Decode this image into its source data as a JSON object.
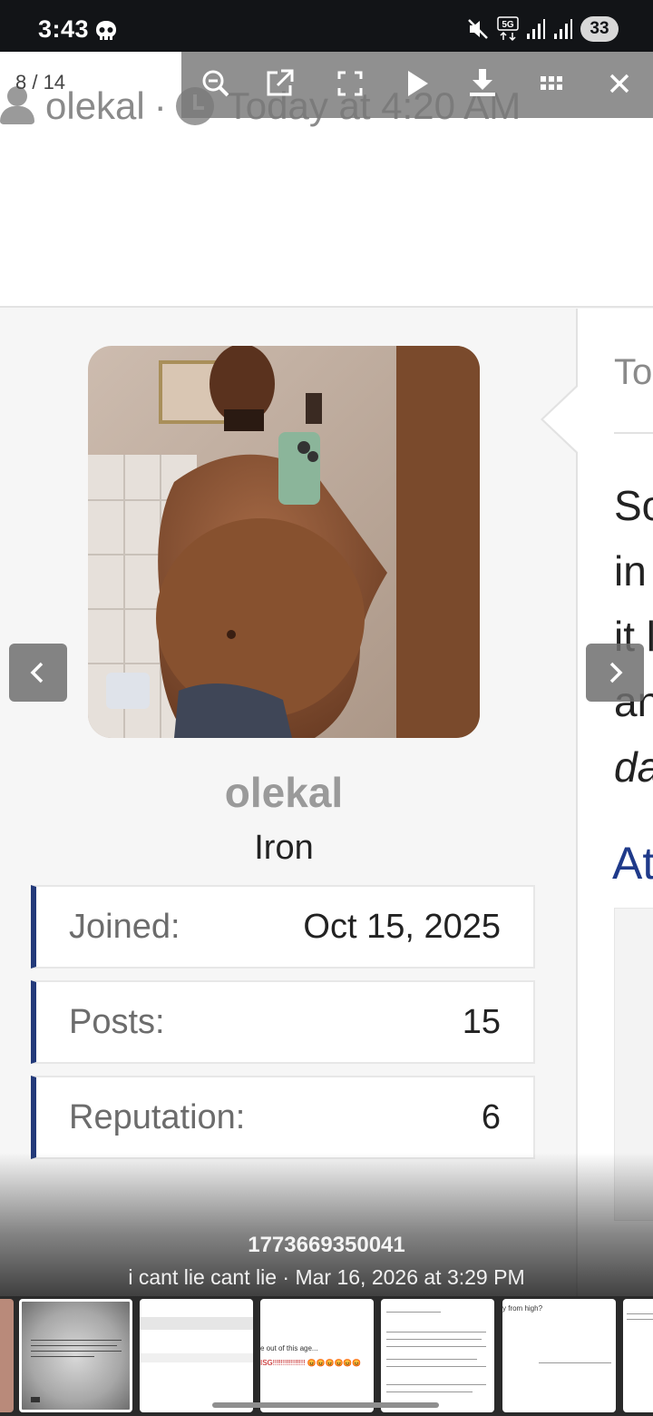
{
  "status_bar": {
    "time": "3:43",
    "battery": "33",
    "icons": [
      "skull-icon",
      "mute-icon",
      "5g-icon",
      "signal-icon",
      "signal-icon"
    ]
  },
  "viewer": {
    "counter": "8 / 14",
    "toolbar": [
      "zoom-out-icon",
      "open-external-icon",
      "fullscreen-icon",
      "play-icon",
      "download-icon",
      "grid-icon",
      "close-icon"
    ],
    "caption_title": "1773669350041",
    "caption_sub": "i cant lie cant lie · Mar 16, 2026 at 3:29 PM"
  },
  "post": {
    "author": "olekal",
    "separator": "·",
    "timestamp": "Today at 4:20 AM",
    "right_date": "Toc",
    "right_lines": [
      "So",
      "in",
      "it l",
      "an",
      "da"
    ],
    "attachments_fragment": "At"
  },
  "profile": {
    "username": "olekal",
    "rank": "Iron",
    "stats": [
      {
        "label": "Joined:",
        "value": "Oct 15, 2025"
      },
      {
        "label": "Posts:",
        "value": "15"
      },
      {
        "label": "Reputation:",
        "value": "6"
      }
    ]
  },
  "thumbs": {
    "thumb4_text": "e out of this age...",
    "thumb5_text": "ISG!!!!!!!!!!!!!!!! 😡😡😡😡😡😡",
    "thumb7_text": "y from high?"
  },
  "colors": {
    "accent_blue": "#233a7a",
    "link_blue": "#1f3a8a",
    "status_bar": "#121417"
  }
}
